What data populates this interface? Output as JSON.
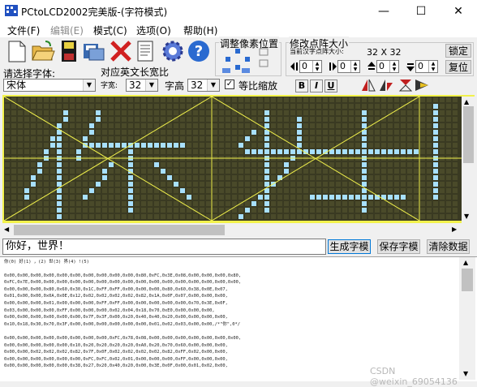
{
  "window": {
    "title": "PCtoLCD2002完美版-(字符模式)",
    "minimize_glyph": "—",
    "maximize_glyph": "☐",
    "close_glyph": "✕"
  },
  "menu": [
    {
      "label": "文件(F)",
      "enabled": true
    },
    {
      "label": "编辑(E)",
      "enabled": false
    },
    {
      "label": "模式(C)",
      "enabled": true
    },
    {
      "label": "选项(O)",
      "enabled": true
    },
    {
      "label": "帮助(H)",
      "enabled": true
    }
  ],
  "toolbar": {
    "icons": [
      "new-file-icon",
      "open-folder-icon",
      "save-disk-icon",
      "save-as-icon",
      "delete-x-icon",
      "document-icon",
      "settings-gear-icon",
      "help-question-icon"
    ],
    "font_label": "请选择字体:",
    "font_value": "宋体",
    "ratio_label": "对应英文长宽比",
    "width_label": "字宽:",
    "width_value": "32",
    "height_label": "字高",
    "height_value": "32",
    "proportional_label": "等比缩放",
    "proportional_checked": true,
    "bold_label": "B",
    "italic_label": "I",
    "underline_label": "U"
  },
  "pixel_adjust": {
    "title": "调整像素位置"
  },
  "matrix_size": {
    "title": "修改点阵大小",
    "current_label": "当前汉字点阵大小:",
    "current_value": "32 X 32",
    "lock_button": "锁定",
    "reset_button": "复位",
    "spin_values": [
      "0",
      "0",
      "0",
      "0"
    ]
  },
  "editor": {
    "grid_color": "#3a3a22",
    "pixel_on": "#a8e0ff",
    "pixel_off": "#4a4a2a",
    "border_color": "#f2f24c"
  },
  "input": {
    "text": "你好，世界！",
    "generate_button": "生成字模",
    "save_button": "保存字模",
    "clear_button": "清除数据"
  },
  "output": {
    "header": "你(0) 好(1) ，(2) 世(3) 界(4) !(5)",
    "lines": [
      "0x00,0x00,0x00,0x00,0x00,0x00,0x00,0x00,0x00,0x00,0x80,0xFC,0x3E,0x08,0x00,0x00,0x00,0x80,",
      "0xFC,0x7E,0x00,0x00,0x00,0x00,0x00,0x00,0x00,0x00,0x00,0x00,0x00,0x00,0x00,0x00,0x00,0x00,",
      "0x00,0x00,0x00,0x80,0x60,0x30,0x1C,0xFF,0xFF,0x00,0x00,0x00,0x80,0x60,0x38,0x0E,0x07,",
      "0x01,0x00,0x00,0x0A,0x0E,0x12,0x02,0x02,0x02,0x02,0x82,0x1A,0x0F,0x07,0x00,0x00,0x00,",
      "0x00,0x00,0x00,0x01,0x00,0x00,0x00,0xFF,0xFF,0x00,0x00,0x00,0x00,0x00,0x70,0x3E,0x0F,",
      "0x03,0x00,0x00,0x00,0xFF,0x00,0x00,0x00,0x02,0x04,0x18,0x70,0xE0,0x00,0x00,0x00,",
      "0x00,0x00,0x00,0x00,0x00,0x00,0x7F,0x3F,0x00,0x20,0x40,0x40,0x20,0x00,0x00,0x00,0x00,",
      "0x10,0x18,0x30,0x70,0x3F,0x00,0x00,0x00,0x00,0x00,0x00,0x01,0x02,0x03,0x00,0x00,/*\"你\",0*/",
      "",
      "0x00,0x00,0x00,0x00,0x00,0x00,0x00,0x00,0xFC,0x78,0x08,0x00,0x00,0x00,0x00,0x00,0x00,0x00,",
      "0x00,0x00,0x00,0x00,0x00,0x10,0x20,0x20,0x20,0x20,0xA0,0x20,0x70,0x60,0x00,0x00,0x00,",
      "0x00,0x00,0x02,0x02,0x02,0x82,0x7F,0x0F,0x02,0x02,0x02,0x02,0x82,0xFF,0x02,0x00,0x00,",
      "0x00,0x00,0x00,0x00,0x00,0x00,0xFC,0xFC,0x02,0x01,0x00,0x00,0x00,0xFF,0x00,0x00,0x00,",
      "0x00,0x00,0x00,0x00,0x00,0x38,0x27,0x20,0x40,0x20,0x00,0x3E,0x0F,0x00,0x01,0x02,0x00,"
    ]
  },
  "watermark": "CSDN @weixin_69054136"
}
